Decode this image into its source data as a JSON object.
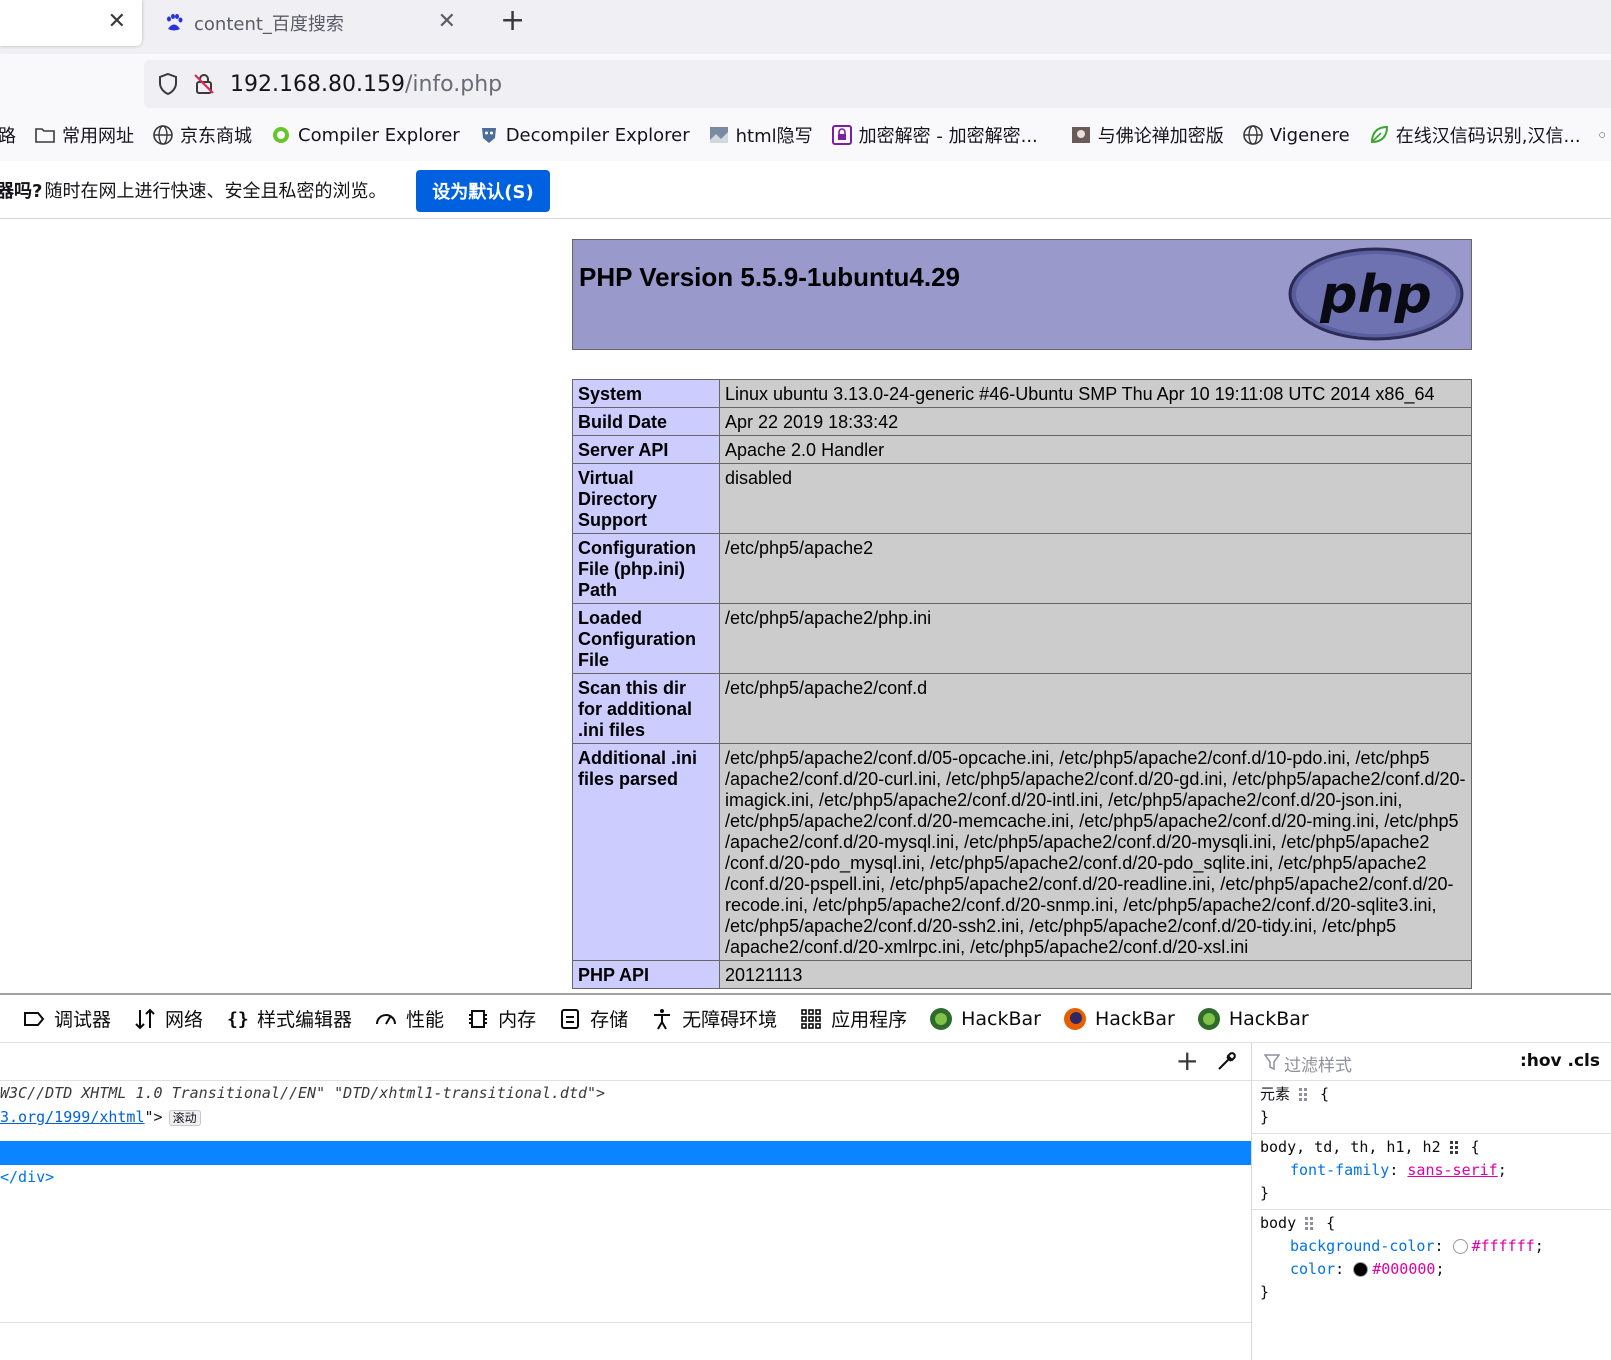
{
  "tabs": [
    {
      "title": "",
      "active": true
    },
    {
      "title": "content_百度搜索",
      "active": false
    }
  ],
  "urlbar": {
    "host": "192.168.80.159",
    "path": "/info.php"
  },
  "bookmarks": [
    {
      "label": "路",
      "icon": "folder-icon"
    },
    {
      "label": "常用网址",
      "icon": "folder-icon"
    },
    {
      "label": "京东商城",
      "icon": "globe-icon"
    },
    {
      "label": "Compiler Explorer",
      "icon": "compiler-explorer-icon"
    },
    {
      "label": "Decompiler Explorer",
      "icon": "decompiler-explorer-icon"
    },
    {
      "label": "html隐写",
      "icon": "image-icon"
    },
    {
      "label": "加密解密 - 加密解密...",
      "icon": "lock-app-icon"
    },
    {
      "label": "与佛论禅加密版",
      "icon": "image-icon"
    },
    {
      "label": "Vigenere",
      "icon": "globe-icon"
    },
    {
      "label": "在线汉信码识别,汉信...",
      "icon": "leaf-icon"
    }
  ],
  "notice": {
    "bold": "器吗?",
    "text": "随时在网上进行快速、安全且私密的浏览。",
    "button": "设为默认(S)"
  },
  "php": {
    "title": "PHP Version 5.5.9-1ubuntu4.29",
    "logo_text": "php",
    "rows": [
      {
        "key": "System",
        "value": "Linux ubuntu 3.13.0-24-generic #46-Ubuntu SMP Thu Apr 10 19:11:08 UTC 2014 x86_64"
      },
      {
        "key": "Build Date",
        "value": "Apr 22 2019 18:33:42"
      },
      {
        "key": "Server API",
        "value": "Apache 2.0 Handler"
      },
      {
        "key": "Virtual Directory Support",
        "value": "disabled"
      },
      {
        "key": "Configuration File (php.ini) Path",
        "value": "/etc/php5/apache2"
      },
      {
        "key": "Loaded Configuration File",
        "value": "/etc/php5/apache2/php.ini"
      },
      {
        "key": "Scan this dir for additional .ini files",
        "value": "/etc/php5/apache2/conf.d"
      },
      {
        "key": "Additional .ini files parsed",
        "value": "/etc/php5/apache2/conf.d/05-opcache.ini, /etc/php5/apache2/conf.d/10-pdo.ini, /etc/php5 /apache2/conf.d/20-curl.ini, /etc/php5/apache2/conf.d/20-gd.ini, /etc/php5/apache2/conf.d/20-imagick.ini, /etc/php5/apache2/conf.d/20-intl.ini, /etc/php5/apache2/conf.d/20-json.ini, /etc/php5/apache2/conf.d/20-memcache.ini, /etc/php5/apache2/conf.d/20-ming.ini, /etc/php5 /apache2/conf.d/20-mysql.ini, /etc/php5/apache2/conf.d/20-mysqli.ini, /etc/php5/apache2 /conf.d/20-pdo_mysql.ini, /etc/php5/apache2/conf.d/20-pdo_sqlite.ini, /etc/php5/apache2 /conf.d/20-pspell.ini, /etc/php5/apache2/conf.d/20-readline.ini, /etc/php5/apache2/conf.d/20-recode.ini, /etc/php5/apache2/conf.d/20-snmp.ini, /etc/php5/apache2/conf.d/20-sqlite3.ini, /etc/php5/apache2/conf.d/20-ssh2.ini, /etc/php5/apache2/conf.d/20-tidy.ini, /etc/php5 /apache2/conf.d/20-xmlrpc.ini, /etc/php5/apache2/conf.d/20-xsl.ini"
      },
      {
        "key": "PHP API",
        "value": "20121113"
      }
    ]
  },
  "devtools": {
    "tabs": [
      {
        "label": "调试器",
        "icon": "debugger-icon"
      },
      {
        "label": "网络",
        "icon": "network-icon"
      },
      {
        "label": "样式编辑器",
        "icon": "style-editor-icon"
      },
      {
        "label": "性能",
        "icon": "performance-icon"
      },
      {
        "label": "内存",
        "icon": "memory-icon"
      },
      {
        "label": "存储",
        "icon": "storage-icon"
      },
      {
        "label": "无障碍环境",
        "icon": "accessibility-icon"
      },
      {
        "label": "应用程序",
        "icon": "application-icon"
      },
      {
        "label": "HackBar",
        "icon": "hackbar-green-icon"
      },
      {
        "label": "HackBar",
        "icon": "hackbar-orange-icon"
      },
      {
        "label": "HackBar",
        "icon": "hackbar-green-icon"
      }
    ],
    "markup": {
      "doctype": "W3C//DTD XHTML 1.0 Transitional//EN\" \"DTD/xhtml1-transitional.dtd\">",
      "html_url": "3.org/1999/xhtml",
      "html_tail": "\">",
      "scroll_badge": "滚动",
      "div_close": "</div>"
    },
    "rules": {
      "filter_placeholder": "过滤样式",
      "hov_cls": ":hov .cls",
      "element_label": "元素",
      "rule1_selector": "body, td, th, h1, h2",
      "rule1_prop": "font-family",
      "rule1_value": "sans-serif",
      "rule2_selector": "body",
      "rule2_prop1": "background-color",
      "rule2_value1": "#ffffff",
      "rule2_prop2": "color",
      "rule2_value2": "#000000"
    }
  },
  "colors": {
    "php_header": "#9999cc",
    "key_cell": "#ccccff",
    "value_cell": "#cccccc",
    "accent": "#0061e0",
    "devtools_selection": "#0a84ff"
  }
}
